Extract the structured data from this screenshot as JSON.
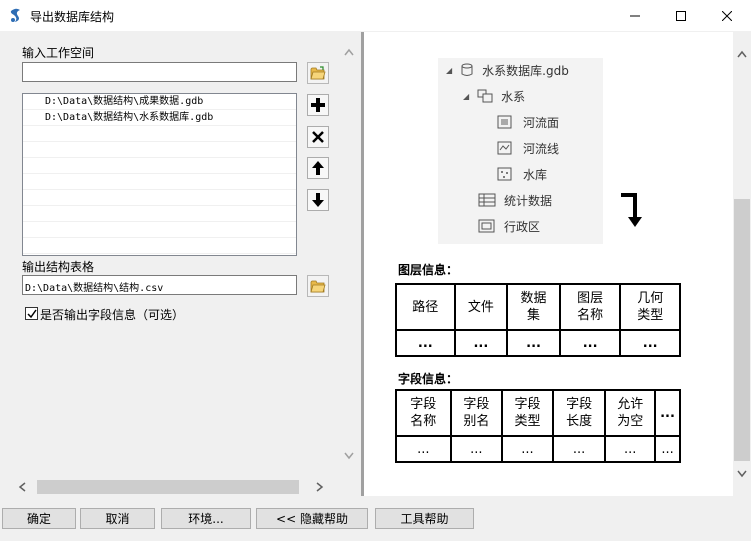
{
  "window": {
    "title": "导出数据库结构"
  },
  "workspace": {
    "label": "输入工作空间",
    "value": ""
  },
  "list": {
    "items": [
      "D:\\Data\\数据结构\\成果数据.gdb",
      "D:\\Data\\数据结构\\水系数据库.gdb"
    ]
  },
  "output": {
    "label": "输出结构表格",
    "value": "D:\\Data\\数据结构\\结构.csv"
  },
  "checkbox": {
    "label": "是否输出字段信息（可选）",
    "checked": true
  },
  "buttons": {
    "ok": "确定",
    "cancel": "取消",
    "env": "环境...",
    "hide_help": "<< 隐藏帮助",
    "tool_help": "工具帮助"
  },
  "help": {
    "tree": {
      "gdb": "水系数据库.gdb",
      "dataset": "水系",
      "fc1": "河流面",
      "fc2": "河流线",
      "fc3": "水库",
      "table1": "统计数据",
      "raster": "行政区"
    },
    "layer_info_title": "图层信息：",
    "layer_headers": [
      "路径",
      "文件",
      "数据\n集",
      "图层\n名称",
      "几何\n类型"
    ],
    "layer_values": [
      "...",
      "...",
      "...",
      "...",
      "..."
    ],
    "field_info_title": "字段信息：",
    "field_headers": [
      "字段\n名称",
      "字段\n别名",
      "字段\n类型",
      "字段\n长度",
      "允许\n为空",
      "..."
    ],
    "field_values": [
      "...",
      "...",
      "...",
      "...",
      "...",
      "..."
    ]
  }
}
